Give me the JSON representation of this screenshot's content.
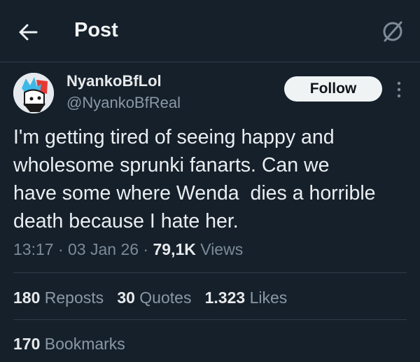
{
  "header": {
    "title": "Post",
    "back_icon": "arrow-left-icon",
    "grok_icon": "grok-icon"
  },
  "author": {
    "display_name": "NyankoBfLol",
    "handle": "@NyankoBfReal",
    "avatar_icon": "cartoon-avatar"
  },
  "actions": {
    "follow_label": "Follow",
    "more_icon": "more-vertical-icon"
  },
  "post": {
    "text": "I'm getting tired of seeing happy and\nwholesome sprunki fanarts. Can we\nhave some where Wenda  dies a horrible\ndeath because I hate her."
  },
  "meta": {
    "time": "13:17",
    "date": "03 Jan 26",
    "views_count": "79,1K",
    "views_label": "Views"
  },
  "stats": {
    "reposts_count": "180",
    "reposts_label": "Reposts",
    "quotes_count": "30",
    "quotes_label": "Quotes",
    "likes_count": "1.323",
    "likes_label": "Likes",
    "bookmarks_count": "170",
    "bookmarks_label": "Bookmarks"
  },
  "colors": {
    "background": "#15202b",
    "text": "#e7e9ea",
    "muted": "#8b98a5",
    "divider": "#2f3b48",
    "follow_bg": "#eff3f4"
  }
}
